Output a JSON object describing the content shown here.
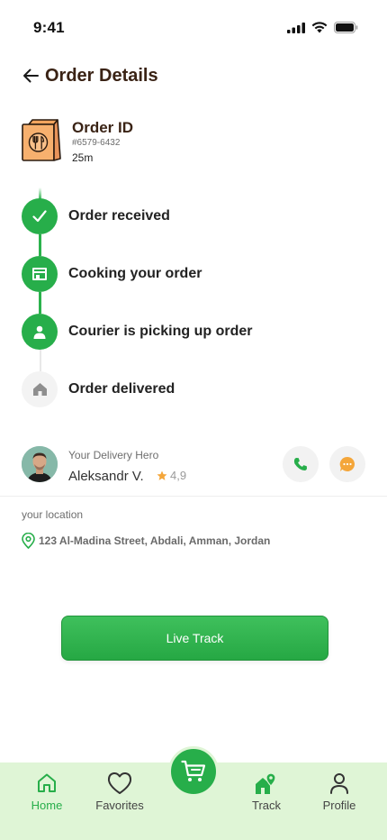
{
  "status_bar": {
    "time": "9:41"
  },
  "header": {
    "title": "Order Details"
  },
  "order": {
    "label": "Order ID",
    "number": "#6579-6432",
    "eta": "25m"
  },
  "timeline": {
    "steps": [
      {
        "label": "Order received",
        "icon": "check-icon",
        "state": "done"
      },
      {
        "label": "Cooking your order",
        "icon": "store-icon",
        "state": "done"
      },
      {
        "label": "Courier is picking up order",
        "icon": "person-icon",
        "state": "done"
      },
      {
        "label": "Order delivered",
        "icon": "home-icon",
        "state": "pending"
      }
    ]
  },
  "courier": {
    "role": "Your Delivery Hero",
    "name": "Aleksandr V.",
    "rating": "4,9"
  },
  "location": {
    "label": "your location",
    "address": "123 Al-Madina Street, Abdali, Amman, Jordan"
  },
  "actions": {
    "live_track_label": "Live Track"
  },
  "bottom_nav": {
    "items": [
      {
        "label": "Home",
        "icon": "home-icon",
        "active": true
      },
      {
        "label": "Favorites",
        "icon": "heart-icon",
        "active": false
      },
      {
        "label": "Track",
        "icon": "track-icon",
        "active": false
      },
      {
        "label": "Profile",
        "icon": "profile-icon",
        "active": false
      }
    ],
    "cart_icon": "cart-icon"
  },
  "colors": {
    "accent": "#27ae4a",
    "title": "#3a2315",
    "nav_bg": "#dff5d6",
    "chat": "#f4a63a"
  }
}
